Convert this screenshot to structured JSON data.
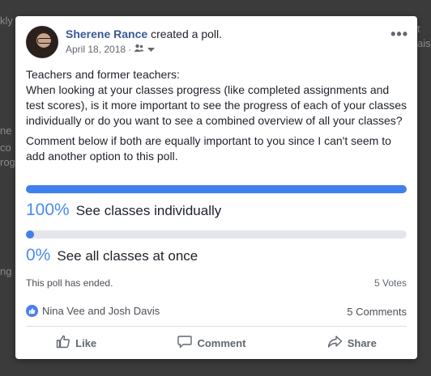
{
  "post": {
    "author": "Sherene Rance",
    "action": "created a poll.",
    "date": "April 18, 2018",
    "separator": "·",
    "more_icon": "•••",
    "paragraphs": [
      "Teachers and former teachers:\nWhen looking at your classes progress (like completed assignments and test scores), is it more important to see the progress of each of your classes individually or do you want to see a combined overview of all your classes?",
      "Comment below if both are equally important to you since I can't seem to add another option to this poll."
    ]
  },
  "poll": {
    "options": [
      {
        "percent": "100%",
        "value": 1.0,
        "label": "See classes individually"
      },
      {
        "percent": "0%",
        "value": 0.0,
        "label": "See all classes at once"
      }
    ],
    "status": "This poll has ended.",
    "votes": "5 Votes"
  },
  "engagement": {
    "likers": "Nina Vee and Josh Davis",
    "comments": "5 Comments"
  },
  "actions": {
    "like": "Like",
    "comment": "Comment",
    "share": "Share"
  },
  "colors": {
    "accent": "#4080ec",
    "author": "#385898",
    "track": "#e4e6eb"
  }
}
